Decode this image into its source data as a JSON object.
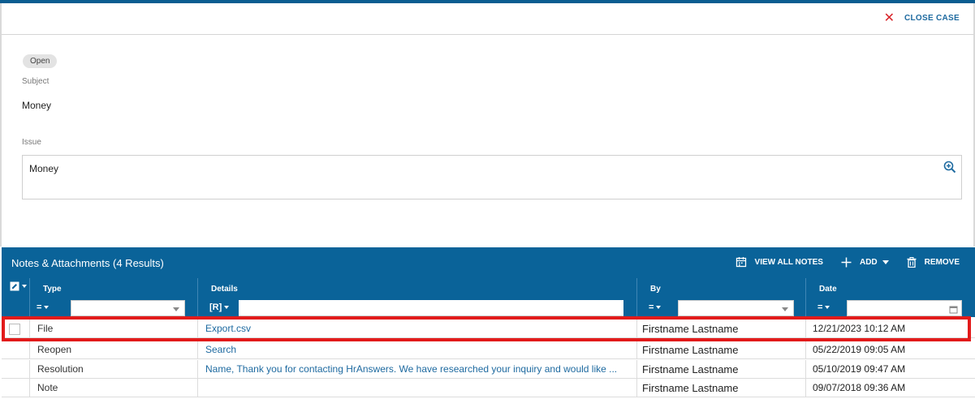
{
  "case": {
    "close_label": "CLOSE CASE",
    "status": "Open",
    "subject_label": "Subject",
    "subject_value": "Money",
    "issue_label": "Issue",
    "issue_value": "Money"
  },
  "notes": {
    "title": "Notes & Attachments (4 Results)",
    "actions": {
      "view_all": "VIEW ALL NOTES",
      "add": "ADD",
      "remove": "REMOVE"
    },
    "columns": {
      "type": "Type",
      "details": "Details",
      "by": "By",
      "date": "Date"
    },
    "filters": {
      "type_op": "=",
      "details_op": "[R]",
      "by_op": "=",
      "date_op": "="
    },
    "rows": [
      {
        "type": "File",
        "details": "Export.csv",
        "by": "Firstname Lastname",
        "date": "12/21/2023 10:12 AM"
      },
      {
        "type": "Reopen",
        "details": "Search",
        "by": "Firstname Lastname",
        "date": "05/22/2019 09:05 AM"
      },
      {
        "type": "Resolution",
        "details": "Name, Thank you for contacting HrAnswers. We have researched your inquiry and would like ...",
        "by": "Firstname Lastname",
        "date": "05/10/2019 09:47 AM"
      },
      {
        "type": "Note",
        "details": "",
        "by": "Firstname Lastname",
        "date": "09/07/2018 09:36 AM"
      }
    ]
  },
  "colors": {
    "accent": "#0a6399",
    "link": "#1e6aa0",
    "close": "#d9262b",
    "highlight": "#e21b1b"
  }
}
